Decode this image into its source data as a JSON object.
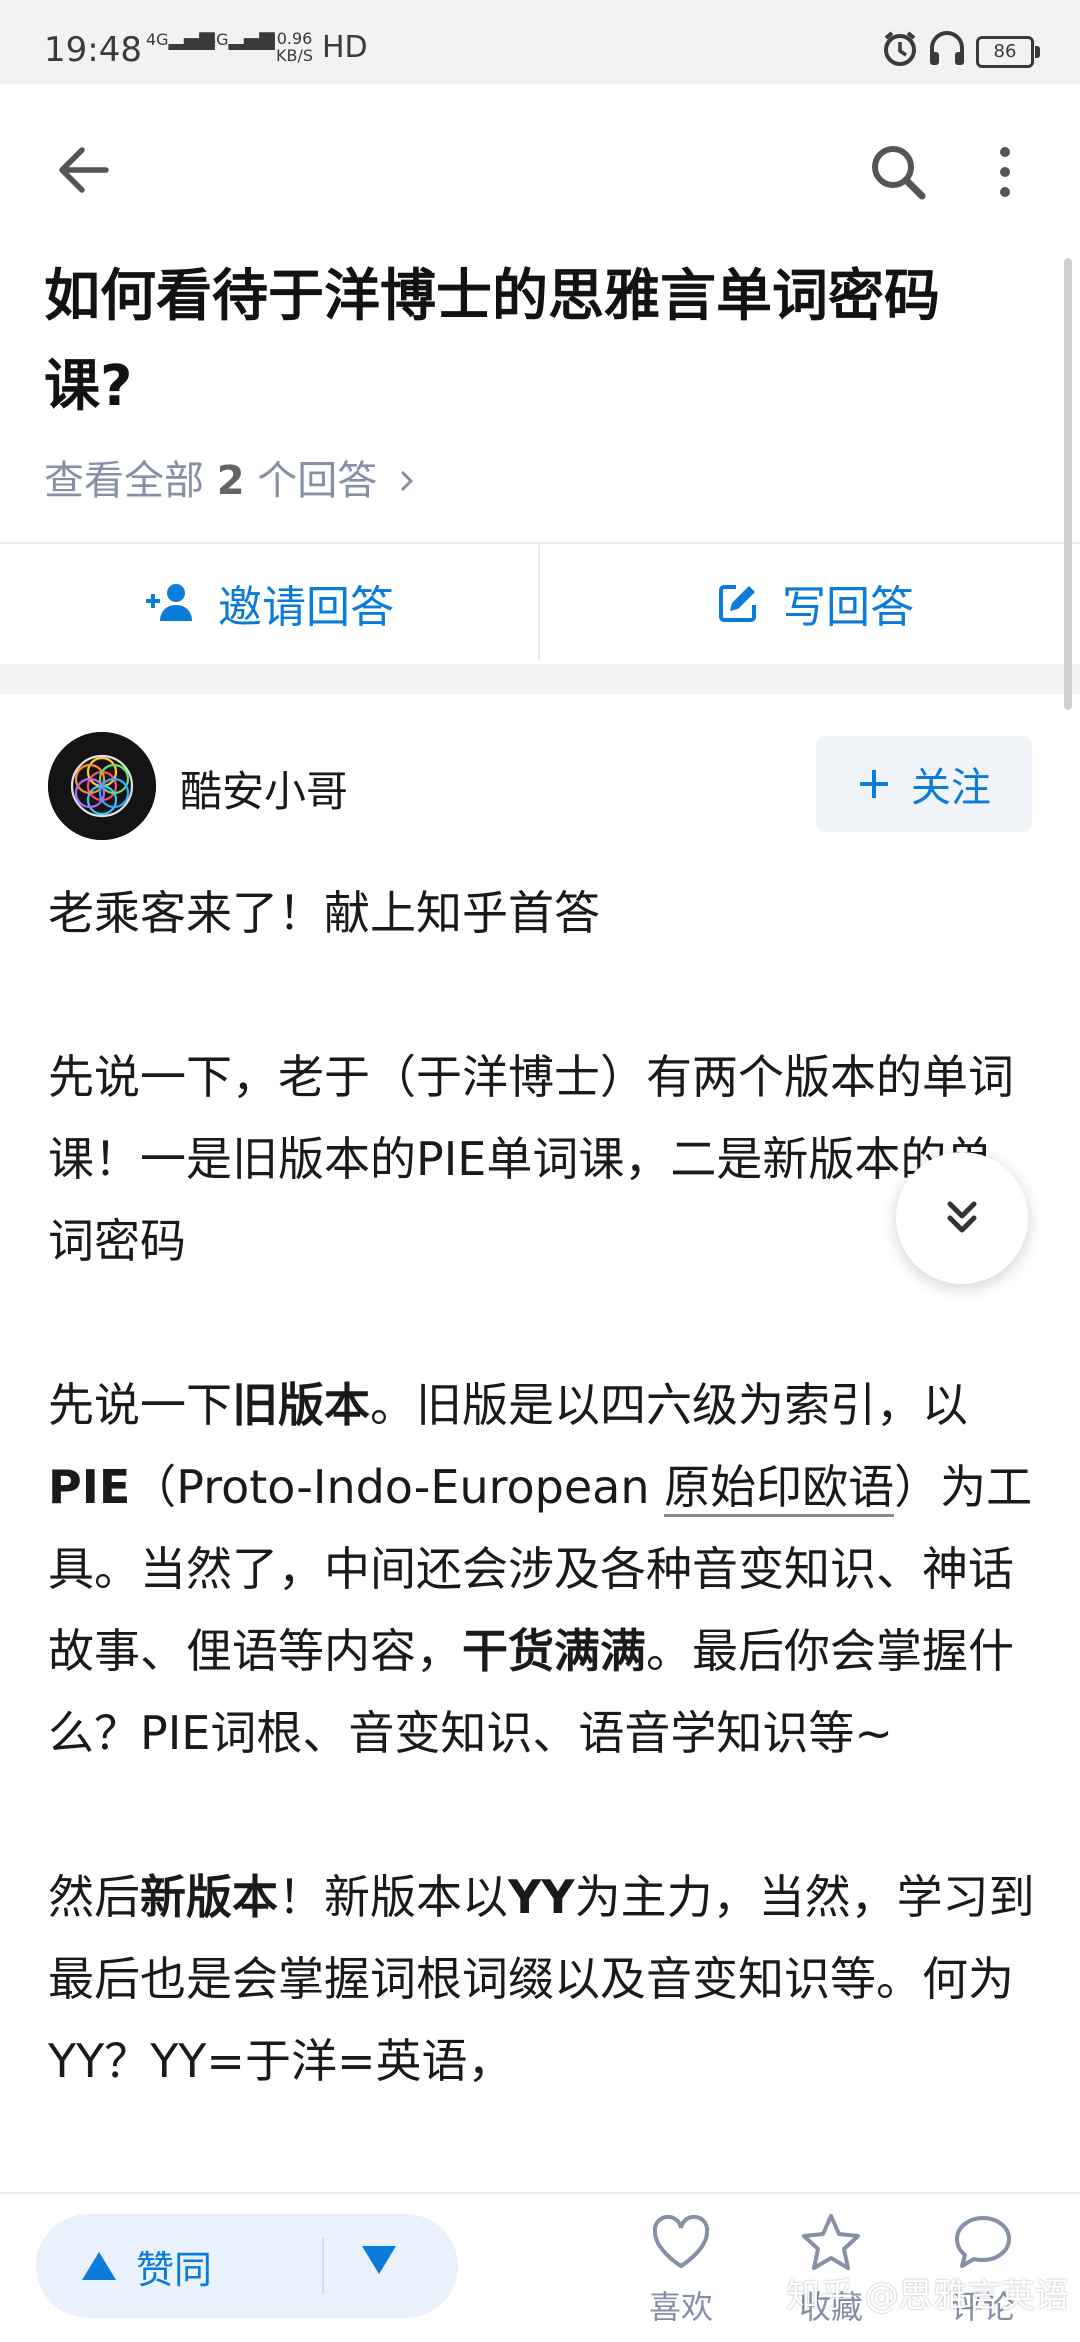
{
  "status_bar": {
    "time": "19:48",
    "signal_1": "4G",
    "signal_2": "4G",
    "net_speed_value": "0.96",
    "net_speed_unit": "KB/S",
    "hd": "HD",
    "battery": "86"
  },
  "question": {
    "title": "如何看待于洋博士的思雅言单词密码课?",
    "view_all_prefix": "查看全部",
    "answer_count": "2",
    "view_all_suffix": "个回答"
  },
  "actions": {
    "invite": "邀请回答",
    "write": "写回答"
  },
  "author": {
    "name": "酷安小哥",
    "follow": "关注"
  },
  "answer": {
    "p1": "老乘客来了！献上知乎首答",
    "p2": "先说一下，老于（于洋博士）有两个版本的单词课！一是旧版本的PIE单词课，二是新版本的单词密码",
    "p3_a": "先说一下",
    "p3_b": "旧版本",
    "p3_c": "。旧版是以四六级为索引，以",
    "p3_d": "PIE",
    "p3_e": "（Proto-Indo-European ",
    "p3_f": "原始印欧语",
    "p3_g": "）为工具。当然了，中间还会涉及各种音变知识、神话故事、俚语等内容，",
    "p3_h": "干货满满",
    "p3_i": "。最后你会掌握什么？PIE词根、音变知识、语音学知识等~",
    "p4_a": "然后",
    "p4_b": "新版本",
    "p4_c": "！新版本以",
    "p4_d": "YY",
    "p4_e": "为主力，当然，学习到最后也是会掌握词根词缀以及音变知识等。何为YY？YY=于洋=英语，"
  },
  "bottom_bar": {
    "agree": "赞同",
    "like": "喜欢",
    "favorite": "收藏",
    "comment": "评论",
    "watermark": "知乎 @思雅言英语"
  },
  "colors": {
    "accent": "#0a7bd8",
    "muted": "#8590a6"
  }
}
